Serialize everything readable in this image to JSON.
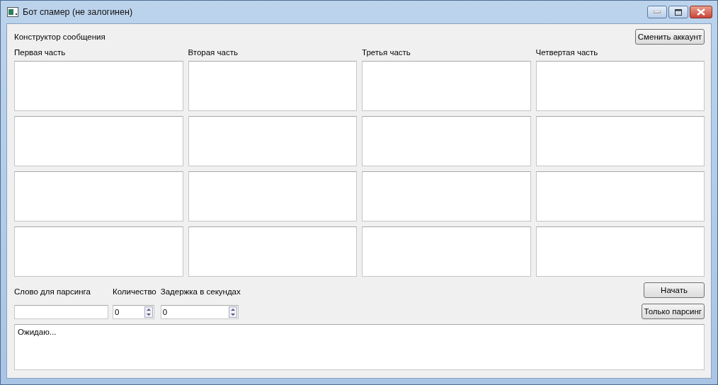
{
  "window": {
    "title": "Бот спамер (не залогинен)"
  },
  "constructor": {
    "title": "Конструктор сообщения",
    "account_button": "Сменить аккаунт",
    "parts": [
      {
        "label": "Первая часть"
      },
      {
        "label": "Вторая часть"
      },
      {
        "label": "Третья часть"
      },
      {
        "label": "Четвертая часть"
      }
    ]
  },
  "controls": {
    "parse_word": {
      "label": "Слово для парсинга"
    },
    "count": {
      "label": "Количество",
      "value": "0"
    },
    "delay": {
      "label": "Задержка в секундах",
      "value": "0"
    },
    "buttons": [
      "Начать",
      "Только парсинг"
    ]
  },
  "log": {
    "text": "Ожидаю..."
  }
}
